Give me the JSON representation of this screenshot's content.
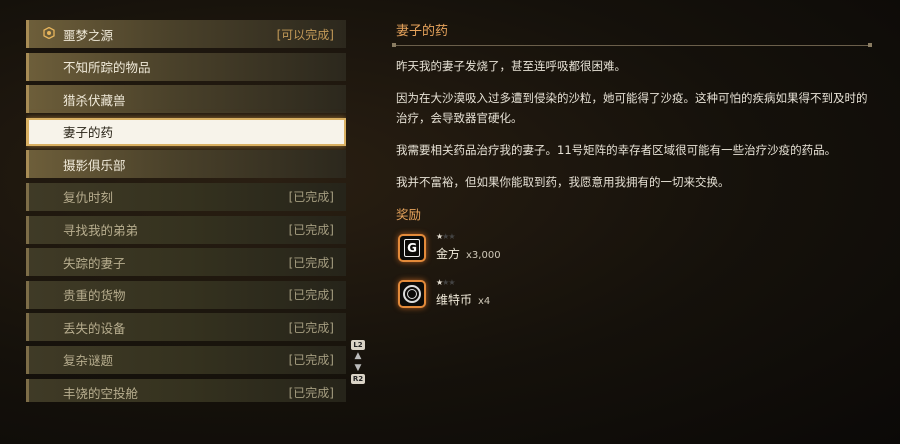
{
  "quests": [
    {
      "name": "噩梦之源",
      "status": "[可以完成]",
      "state": "available",
      "icon": "hexagon-marker-icon"
    },
    {
      "name": "不知所踪的物品",
      "status": "",
      "state": "active"
    },
    {
      "name": "猎杀伏藏兽",
      "status": "",
      "state": "active"
    },
    {
      "name": "妻子的药",
      "status": "",
      "state": "selected"
    },
    {
      "name": "摄影俱乐部",
      "status": "",
      "state": "active"
    },
    {
      "name": "复仇时刻",
      "status": "[已完成]",
      "state": "completed"
    },
    {
      "name": "寻找我的弟弟",
      "status": "[已完成]",
      "state": "completed"
    },
    {
      "name": "失踪的妻子",
      "status": "[已完成]",
      "state": "completed"
    },
    {
      "name": "贵重的货物",
      "status": "[已完成]",
      "state": "completed"
    },
    {
      "name": "丢失的设备",
      "status": "[已完成]",
      "state": "completed"
    },
    {
      "name": "复杂谜题",
      "status": "[已完成]",
      "state": "completed"
    },
    {
      "name": "丰饶的空投舱",
      "status": "[已完成]",
      "state": "completed"
    }
  ],
  "scroll": {
    "up_label": "L2",
    "down_label": "R2"
  },
  "detail": {
    "title": "妻子的药",
    "paragraphs": [
      "昨天我的妻子发烧了，甚至连呼吸都很困难。",
      "因为在大沙漠吸入过多遭到侵染的沙粒，她可能得了沙疫。这种可怕的疾病如果得不到及时的治疗，会导致器官硬化。",
      "我需要相关药品治疗我的妻子。11号矩阵的幸存者区域很可能有一些治疗沙疫的药品。",
      "我并不富裕，但如果你能取到药，我愿意用我拥有的一切来交换。"
    ],
    "rewards_title": "奖励",
    "rewards": [
      {
        "name": "金方",
        "qty": "x3,000",
        "stars": "★★★",
        "stars_filled": 1,
        "icon": "gold-currency-icon",
        "glyph": "G"
      },
      {
        "name": "维特币",
        "qty": "x4",
        "stars": "★★★",
        "stars_filled": 1,
        "icon": "vita-coin-icon"
      }
    ]
  },
  "colors": {
    "accent": "#e6a35c",
    "selected_bg": "#f7f3ea",
    "reward_glow": "#e38a3a"
  }
}
